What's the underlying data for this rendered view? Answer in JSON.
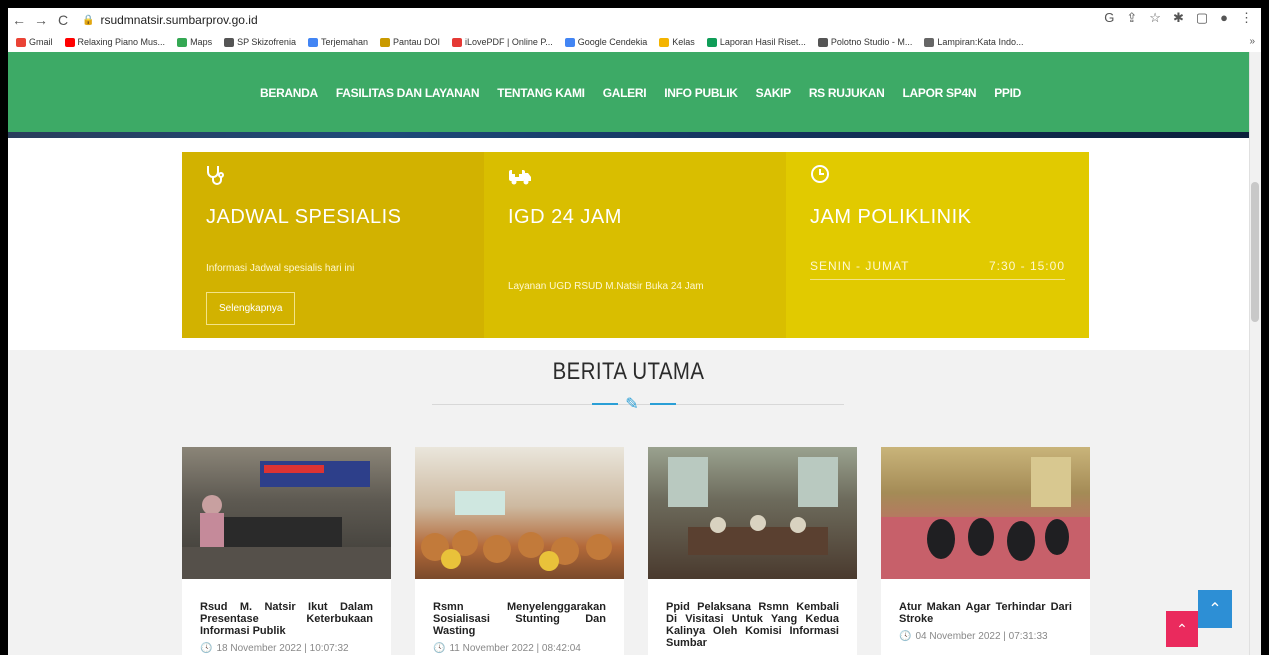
{
  "browser": {
    "url": "rsudmnatsir.sumbarprov.go.id",
    "bookmarks": [
      {
        "label": "Gmail",
        "color": "#ea4335"
      },
      {
        "label": "Relaxing Piano Mus...",
        "color": "#ff0000"
      },
      {
        "label": "Maps",
        "color": "#34a853"
      },
      {
        "label": "SP Skizofrenia",
        "color": "#555555"
      },
      {
        "label": "Terjemahan",
        "color": "#4285f4"
      },
      {
        "label": "Pantau DOI",
        "color": "#c99a00"
      },
      {
        "label": "iLovePDF | Online P...",
        "color": "#e53935"
      },
      {
        "label": "Google Cendekia",
        "color": "#4285f4"
      },
      {
        "label": "Kelas",
        "color": "#f4b400"
      },
      {
        "label": "Laporan Hasil Riset...",
        "color": "#0f9d58"
      },
      {
        "label": "Polotno Studio - M...",
        "color": "#555555"
      },
      {
        "label": "Lampiran:Kata Indo...",
        "color": "#666666"
      }
    ]
  },
  "nav": {
    "items": [
      "BERANDA",
      "FASILITAS DAN LAYANAN",
      "TENTANG KAMI",
      "GALERI",
      "INFO PUBLIK",
      "SAKIP",
      "RS RUJUKAN",
      "LAPOR SP4N",
      "PPID"
    ]
  },
  "boxes": {
    "jadwal": {
      "title": "JADWAL SPESIALIS",
      "desc": "Informasi Jadwal spesialis hari ini",
      "button": "Selengkapnya"
    },
    "igd": {
      "title": "IGD 24 JAM",
      "desc": "Layanan UGD RSUD M.Natsir Buka 24 Jam"
    },
    "poli": {
      "title": "JAM POLIKLINIK",
      "days": "SENIN - JUMAT",
      "hours": "7:30 - 15:00"
    }
  },
  "news": {
    "section_title": "BERITA UTAMA",
    "items": [
      {
        "title": "Rsud M. Natsir Ikut Dalam Presentase Keterbukaan Informasi Publik",
        "date": "18 November 2022 | 10:07:32"
      },
      {
        "title": "Rsmn Menyelenggarakan Sosialisasi Stunting Dan Wasting",
        "date": "11 November 2022 | 08:42:04"
      },
      {
        "title": "Ppid Pelaksana Rsmn Kembali Di Visitasi Untuk Yang Kedua Kalinya Oleh Komisi Informasi Sumbar",
        "date": ""
      },
      {
        "title": "Atur Makan Agar Terhindar Dari Stroke",
        "date": "04 November 2022 | 07:31:33"
      }
    ]
  },
  "colors": {
    "nav_green": "#3daa66",
    "box_yellow": "#d9be00",
    "accent_blue": "#2a9fd6",
    "totop_blue": "#2d8fd5",
    "pink": "#ea2a5d"
  },
  "icons": {
    "jadwal": "stethoscope-icon",
    "igd": "ambulance-icon",
    "poli": "clock-icon"
  }
}
